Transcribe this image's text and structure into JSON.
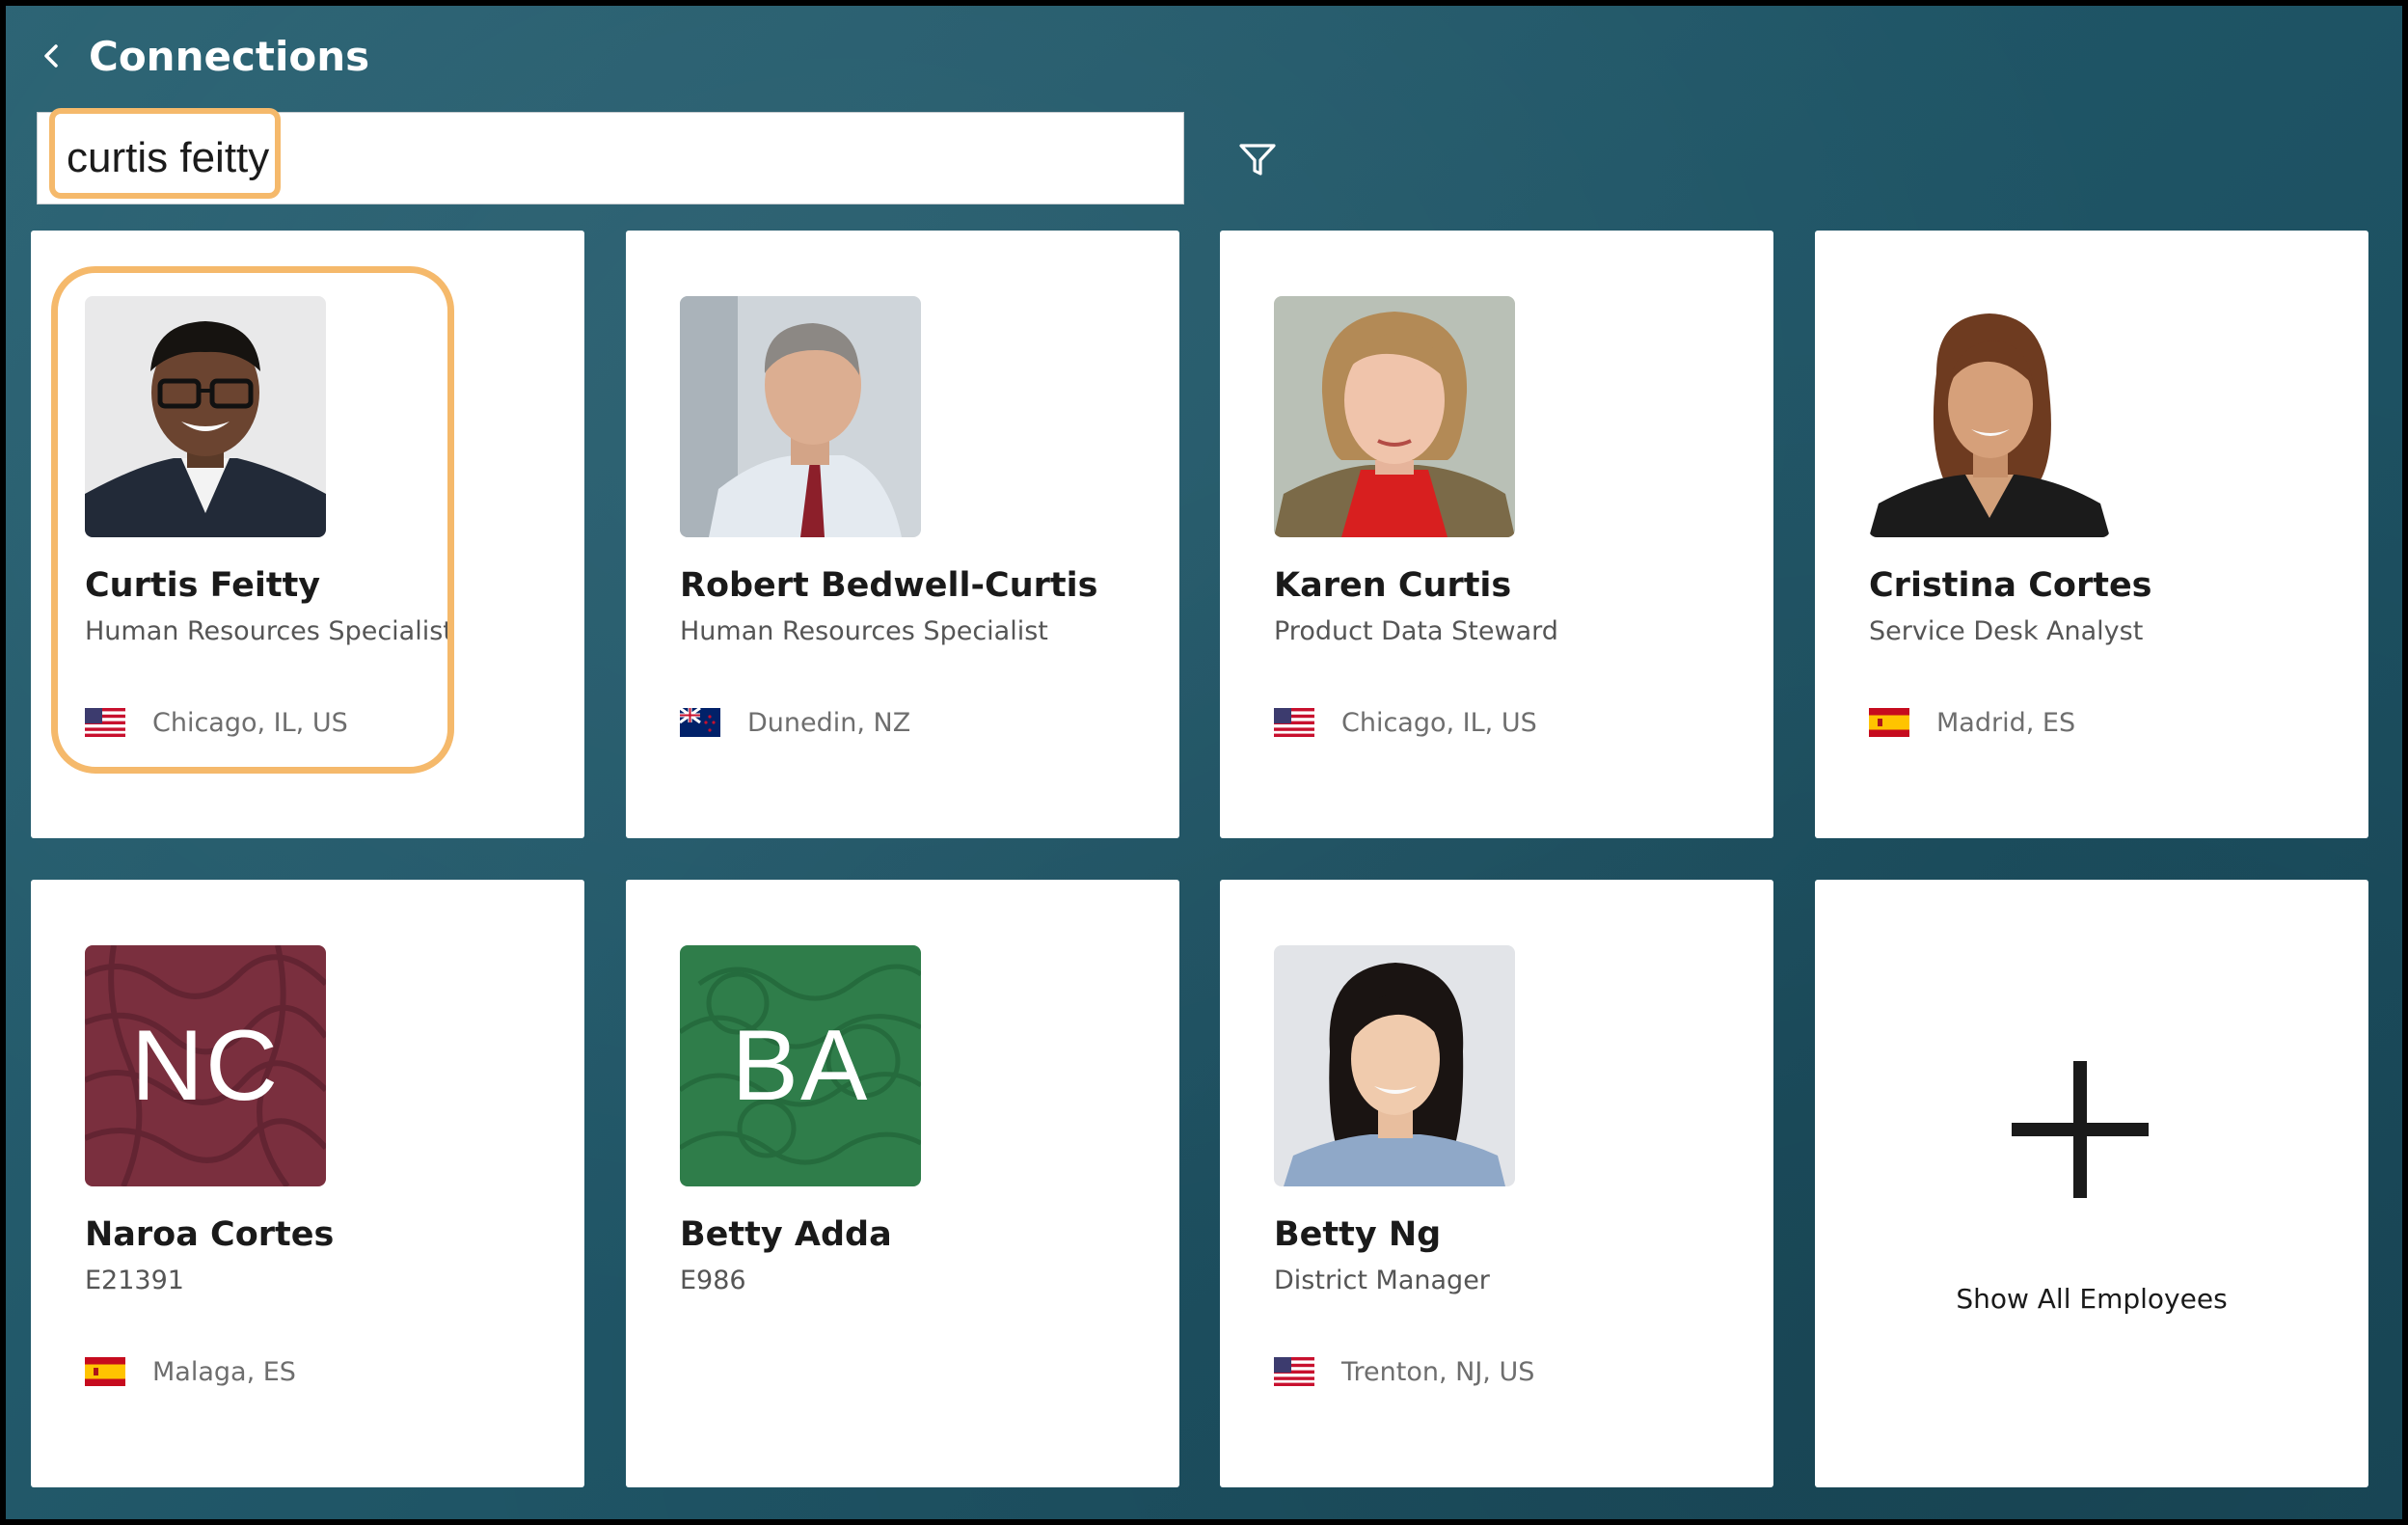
{
  "header": {
    "title": "Connections",
    "back_icon": "chevron-left-icon"
  },
  "search": {
    "value": "curtis feitty",
    "placeholder": ""
  },
  "filter": {
    "icon": "filter-icon"
  },
  "accent_highlight": "#f5b96b",
  "cards": [
    {
      "name": "Curtis Feitty",
      "subtitle": "Human Resources Specialist",
      "location": "Chicago, IL, US",
      "flag": "us-flag-icon",
      "avatar": "photo"
    },
    {
      "name": "Robert Bedwell-Curtis",
      "subtitle": "Human Resources Specialist",
      "location": "Dunedin, NZ",
      "flag": "nz-flag-icon",
      "avatar": "photo"
    },
    {
      "name": "Karen Curtis",
      "subtitle": "Product Data Steward",
      "location": "Chicago, IL, US",
      "flag": "us-flag-icon",
      "avatar": "photo"
    },
    {
      "name": "Cristina Cortes",
      "subtitle": "Service Desk Analyst",
      "location": "Madrid, ES",
      "flag": "es-flag-icon",
      "avatar": "photo"
    },
    {
      "name": "Naroa Cortes",
      "subtitle": "E21391",
      "location": "Malaga, ES",
      "flag": "es-flag-icon",
      "avatar": "initials",
      "initials": "NC",
      "color": "#7a2f3e"
    },
    {
      "name": "Betty Adda",
      "subtitle": "E986",
      "location": "",
      "flag": "",
      "avatar": "initials",
      "initials": "BA",
      "color": "#2f7d4a"
    },
    {
      "name": "Betty Ng",
      "subtitle": "District Manager",
      "location": "Trenton, NJ, US",
      "flag": "us-flag-icon",
      "avatar": "photo"
    }
  ],
  "show_all": {
    "label": "Show All Employees",
    "icon": "plus-icon"
  }
}
